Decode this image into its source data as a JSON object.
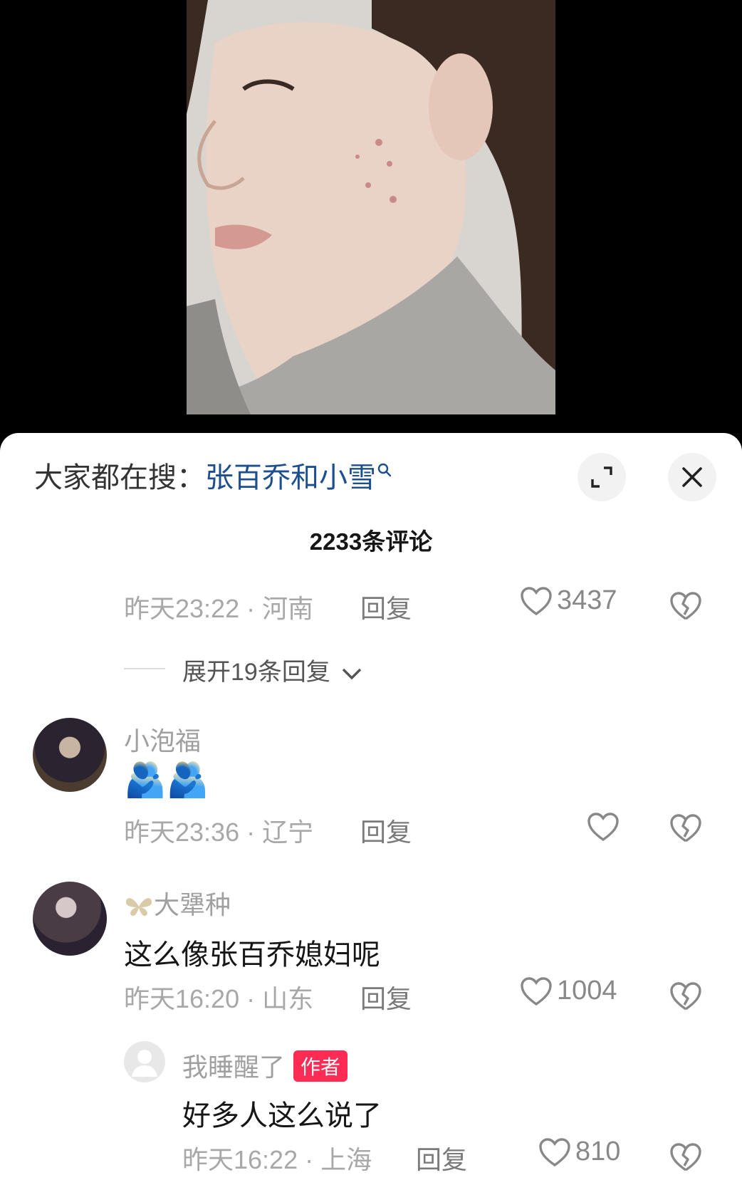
{
  "search": {
    "prefix": "大家都在搜：",
    "term": "张百乔和小雪"
  },
  "comment_count": "2233条评论",
  "comments": [
    {
      "time_loc": "昨天23:22 · 河南",
      "reply": "回复",
      "likes": "3437"
    },
    {
      "username": "小泡福",
      "emoji": "🫂🫂",
      "time_loc": "昨天23:36 · 辽宁",
      "reply": "回复",
      "likes": ""
    },
    {
      "username": "大犟种",
      "text": "这么像张百乔媳妇呢",
      "time_loc": "昨天16:20 · 山东",
      "reply": "回复",
      "likes": "1004"
    },
    {
      "username": "我睡醒了",
      "tag": "作者",
      "text": "好多人这么说了",
      "time_loc": "昨天16:22 · 上海",
      "reply": "回复",
      "likes": "810"
    }
  ],
  "expand_replies": "展开19条回复",
  "colors": {
    "accent": "#fe2c55",
    "search_term": "#1d4f8f"
  },
  "icons": [
    "search-icon",
    "expand-icon",
    "close-icon",
    "heart-icon",
    "broken-heart-icon",
    "chevron-down-icon",
    "butterfly-icon"
  ]
}
